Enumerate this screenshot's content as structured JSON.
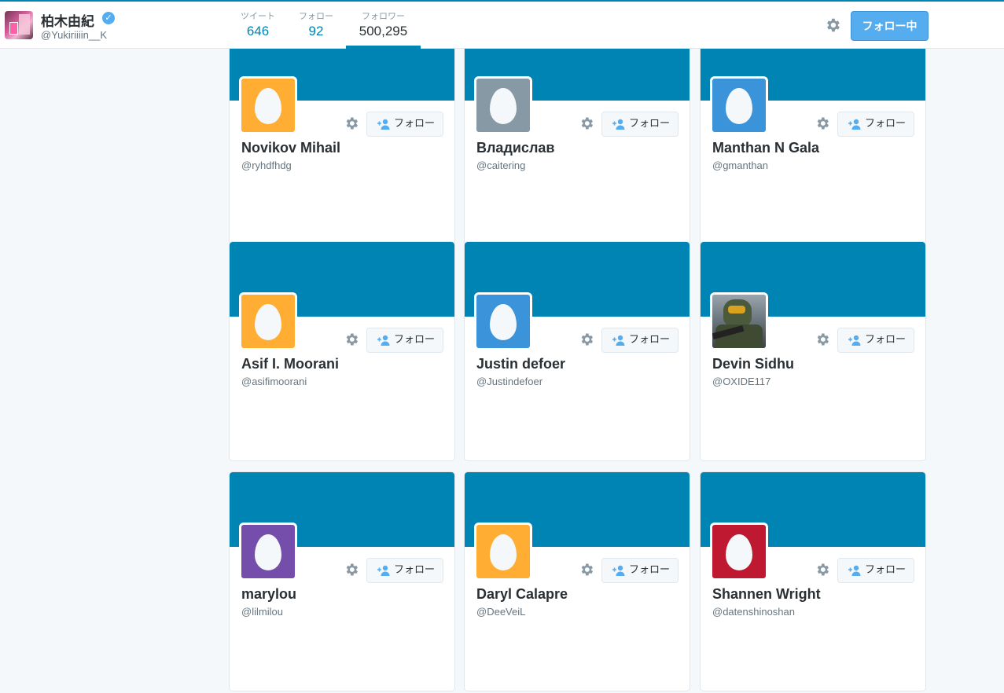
{
  "header": {
    "name": "柏木由紀",
    "handle": "@Yukiriiiin__K",
    "stats": [
      {
        "label": "ツイート",
        "value": "646"
      },
      {
        "label": "フォロー",
        "value": "92"
      },
      {
        "label": "フォロワー",
        "value": "500,295"
      }
    ],
    "active_tab": "フォロワー",
    "following_button": "フォロー中"
  },
  "colors": {
    "accent": "#0084b4",
    "button_blue": "#55acee",
    "egg_bg": "#f5f8fa"
  },
  "cards": [
    {
      "name": "Novikov Mihail",
      "handle": "@ryhdfhdg",
      "avatar": "egg",
      "avatar_color": "#ffad33",
      "follow_label": "フォロー"
    },
    {
      "name": "Владислав",
      "handle": "@caitering",
      "avatar": "egg",
      "avatar_color": "#8899a6",
      "follow_label": "フォロー"
    },
    {
      "name": "Manthan N Gala",
      "handle": "@gmanthan",
      "avatar": "egg",
      "avatar_color": "#3b94d9",
      "follow_label": "フォロー"
    },
    {
      "name": "Asif I. Moorani",
      "handle": "@asifimoorani",
      "avatar": "egg",
      "avatar_color": "#ffad33",
      "follow_label": "フォロー"
    },
    {
      "name": "Justin defoer",
      "handle": "@Justindefoer",
      "avatar": "egg",
      "avatar_color": "#3b94d9",
      "follow_label": "フォロー"
    },
    {
      "name": "Devin Sidhu",
      "handle": "@OXIDE117",
      "avatar": "photo-armored-soldier",
      "avatar_color": "#6d7880",
      "follow_label": "フォロー"
    },
    {
      "name": "marylou",
      "handle": "@lilmilou",
      "avatar": "egg",
      "avatar_color": "#744eaa",
      "follow_label": "フォロー"
    },
    {
      "name": "Daryl Calapre",
      "handle": "@DeeVeiL",
      "avatar": "egg",
      "avatar_color": "#ffad33",
      "follow_label": "フォロー"
    },
    {
      "name": "Shannen Wright",
      "handle": "@datenshinoshan",
      "avatar": "egg",
      "avatar_color": "#be1931",
      "follow_label": "フォロー"
    }
  ]
}
